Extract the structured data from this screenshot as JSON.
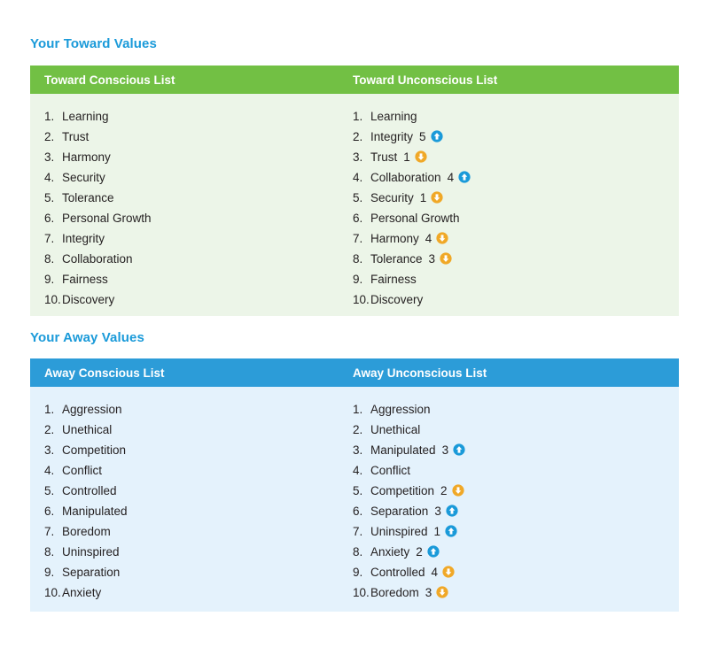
{
  "colors": {
    "heading_blue": "#1a9ad9",
    "green_header": "#72c044",
    "green_body": "#ecf5e8",
    "blue_header": "#2c9cd8",
    "blue_body": "#e4f2fc",
    "up_arrow": "#1a9ad9",
    "down_arrow": "#f0a827",
    "text": "#231f20"
  },
  "sections": [
    {
      "heading": "Your Toward Values",
      "columns": [
        {
          "title": "Toward Conscious List",
          "items": [
            {
              "rank": "1.",
              "label": "Learning",
              "delta": null,
              "icon": null
            },
            {
              "rank": "2.",
              "label": "Trust",
              "delta": null,
              "icon": null
            },
            {
              "rank": "3.",
              "label": "Harmony",
              "delta": null,
              "icon": null
            },
            {
              "rank": "4.",
              "label": "Security",
              "delta": null,
              "icon": null
            },
            {
              "rank": "5.",
              "label": "Tolerance",
              "delta": null,
              "icon": null
            },
            {
              "rank": "6.",
              "label": "Personal Growth",
              "delta": null,
              "icon": null
            },
            {
              "rank": "7.",
              "label": "Integrity",
              "delta": null,
              "icon": null
            },
            {
              "rank": "8.",
              "label": "Collaboration",
              "delta": null,
              "icon": null
            },
            {
              "rank": "9.",
              "label": "Fairness",
              "delta": null,
              "icon": null
            },
            {
              "rank": "10.",
              "label": "Discovery",
              "delta": null,
              "icon": null
            }
          ]
        },
        {
          "title": "Toward Unconscious List",
          "items": [
            {
              "rank": "1.",
              "label": "Learning",
              "delta": null,
              "icon": null
            },
            {
              "rank": "2.",
              "label": "Integrity",
              "delta": "5",
              "icon": "arrow-up-icon"
            },
            {
              "rank": "3.",
              "label": "Trust",
              "delta": "1",
              "icon": "arrow-down-icon"
            },
            {
              "rank": "4.",
              "label": "Collaboration",
              "delta": "4",
              "icon": "arrow-up-icon"
            },
            {
              "rank": "5.",
              "label": "Security",
              "delta": "1",
              "icon": "arrow-down-icon"
            },
            {
              "rank": "6.",
              "label": "Personal Growth",
              "delta": null,
              "icon": null
            },
            {
              "rank": "7.",
              "label": "Harmony",
              "delta": "4",
              "icon": "arrow-down-icon"
            },
            {
              "rank": "8.",
              "label": "Tolerance",
              "delta": "3",
              "icon": "arrow-down-icon"
            },
            {
              "rank": "9.",
              "label": "Fairness",
              "delta": null,
              "icon": null
            },
            {
              "rank": "10.",
              "label": "Discovery",
              "delta": null,
              "icon": null
            }
          ]
        }
      ]
    },
    {
      "heading": "Your Away Values",
      "columns": [
        {
          "title": "Away Conscious List",
          "items": [
            {
              "rank": "1.",
              "label": "Aggression",
              "delta": null,
              "icon": null
            },
            {
              "rank": "2.",
              "label": "Unethical",
              "delta": null,
              "icon": null
            },
            {
              "rank": "3.",
              "label": "Competition",
              "delta": null,
              "icon": null
            },
            {
              "rank": "4.",
              "label": "Conflict",
              "delta": null,
              "icon": null
            },
            {
              "rank": "5.",
              "label": "Controlled",
              "delta": null,
              "icon": null
            },
            {
              "rank": "6.",
              "label": "Manipulated",
              "delta": null,
              "icon": null
            },
            {
              "rank": "7.",
              "label": "Boredom",
              "delta": null,
              "icon": null
            },
            {
              "rank": "8.",
              "label": "Uninspired",
              "delta": null,
              "icon": null
            },
            {
              "rank": "9.",
              "label": "Separation",
              "delta": null,
              "icon": null
            },
            {
              "rank": "10.",
              "label": "Anxiety",
              "delta": null,
              "icon": null
            }
          ]
        },
        {
          "title": "Away Unconscious List",
          "items": [
            {
              "rank": "1.",
              "label": "Aggression",
              "delta": null,
              "icon": null
            },
            {
              "rank": "2.",
              "label": "Unethical",
              "delta": null,
              "icon": null
            },
            {
              "rank": "3.",
              "label": "Manipulated",
              "delta": "3",
              "icon": "arrow-up-icon"
            },
            {
              "rank": "4.",
              "label": "Conflict",
              "delta": null,
              "icon": null
            },
            {
              "rank": "5.",
              "label": "Competition",
              "delta": "2",
              "icon": "arrow-down-icon"
            },
            {
              "rank": "6.",
              "label": "Separation",
              "delta": "3",
              "icon": "arrow-up-icon"
            },
            {
              "rank": "7.",
              "label": "Uninspired",
              "delta": "1",
              "icon": "arrow-up-icon"
            },
            {
              "rank": "8.",
              "label": "Anxiety",
              "delta": "2",
              "icon": "arrow-up-icon"
            },
            {
              "rank": "9.",
              "label": "Controlled",
              "delta": "4",
              "icon": "arrow-down-icon"
            },
            {
              "rank": "10.",
              "label": "Boredom",
              "delta": "3",
              "icon": "arrow-down-icon"
            }
          ]
        }
      ]
    }
  ]
}
